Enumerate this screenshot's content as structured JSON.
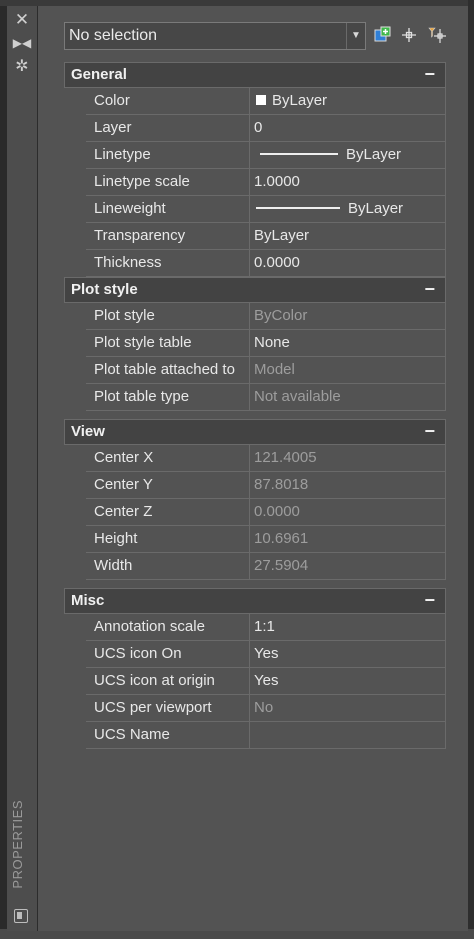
{
  "panel": {
    "title": "PROPERTIES"
  },
  "selector": {
    "value": "No selection"
  },
  "sections": [
    {
      "title": "General",
      "collapse": "−",
      "rows": [
        {
          "name": "Color",
          "value": "ByLayer",
          "swatch": "#ffffff"
        },
        {
          "name": "Layer",
          "value": "0"
        },
        {
          "name": "Linetype",
          "value": "ByLayer"
        },
        {
          "name": "Linetype scale",
          "value": "1.0000"
        },
        {
          "name": "Lineweight",
          "value": "ByLayer"
        },
        {
          "name": "Transparency",
          "value": "ByLayer"
        },
        {
          "name": "Thickness",
          "value": "0.0000"
        }
      ]
    },
    {
      "title": "Plot style",
      "collapse": "−",
      "rows": [
        {
          "name": "Plot style",
          "value": "ByColor"
        },
        {
          "name": "Plot style table",
          "value": "None"
        },
        {
          "name": "Plot table attached to",
          "value": "Model"
        },
        {
          "name": "Plot table type",
          "value": "Not available"
        }
      ]
    },
    {
      "title": "View",
      "collapse": "−",
      "rows": [
        {
          "name": "Center X",
          "value": "121.4005"
        },
        {
          "name": "Center Y",
          "value": "87.8018"
        },
        {
          "name": "Center Z",
          "value": "0.0000"
        },
        {
          "name": "Height",
          "value": "10.6961"
        },
        {
          "name": "Width",
          "value": "27.5904"
        }
      ]
    },
    {
      "title": "Misc",
      "collapse": "−",
      "rows": [
        {
          "name": "Annotation scale",
          "value": "1:1"
        },
        {
          "name": "UCS icon On",
          "value": "Yes"
        },
        {
          "name": "UCS icon at origin",
          "value": "Yes"
        },
        {
          "name": "UCS per viewport",
          "value": "No"
        },
        {
          "name": "UCS Name",
          "value": ""
        }
      ]
    }
  ],
  "colors": {
    "panel_bg": "#535353",
    "header_bg": "#434343",
    "text": "#e8e8e8",
    "readonly_text": "#9d9d9d",
    "grid_line": "#6a6a6a"
  }
}
